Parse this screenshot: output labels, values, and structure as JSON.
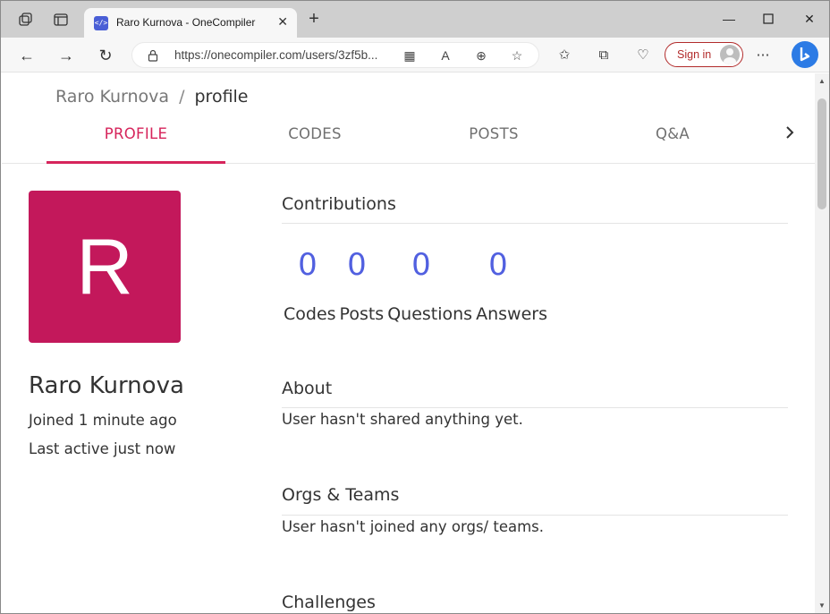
{
  "browser": {
    "tab_title": "Raro Kurnova - OneCompiler",
    "address_url": "https://onecompiler.com/users/3zf5b...",
    "sign_in_label": "Sign in",
    "accent_color": "#b22b2b"
  },
  "page": {
    "breadcrumb": {
      "user": "Raro Kurnova",
      "separator": "/",
      "current": "profile"
    },
    "tabs": [
      {
        "label": "PROFILE",
        "active": true
      },
      {
        "label": "CODES",
        "active": false
      },
      {
        "label": "POSTS",
        "active": false
      },
      {
        "label": "Q&A",
        "active": false
      }
    ],
    "profile": {
      "avatar_letter": "R",
      "avatar_color": "#c3185b",
      "name": "Raro Kurnova",
      "joined": "Joined 1 minute ago",
      "last_active": "Last active just now"
    },
    "contributions": {
      "title": "Contributions",
      "stats": [
        {
          "value": "0",
          "label": "Codes"
        },
        {
          "value": "0",
          "label": "Posts"
        },
        {
          "value": "0",
          "label": "Questions"
        },
        {
          "value": "0",
          "label": "Answers"
        }
      ]
    },
    "about": {
      "title": "About",
      "text": "User hasn't shared anything yet."
    },
    "orgs": {
      "title": "Orgs & Teams",
      "text": "User hasn't joined any orgs/ teams."
    },
    "challenges": {
      "title": "Challenges"
    },
    "accent_color": "#d6245b",
    "stat_color": "#5160e0"
  }
}
